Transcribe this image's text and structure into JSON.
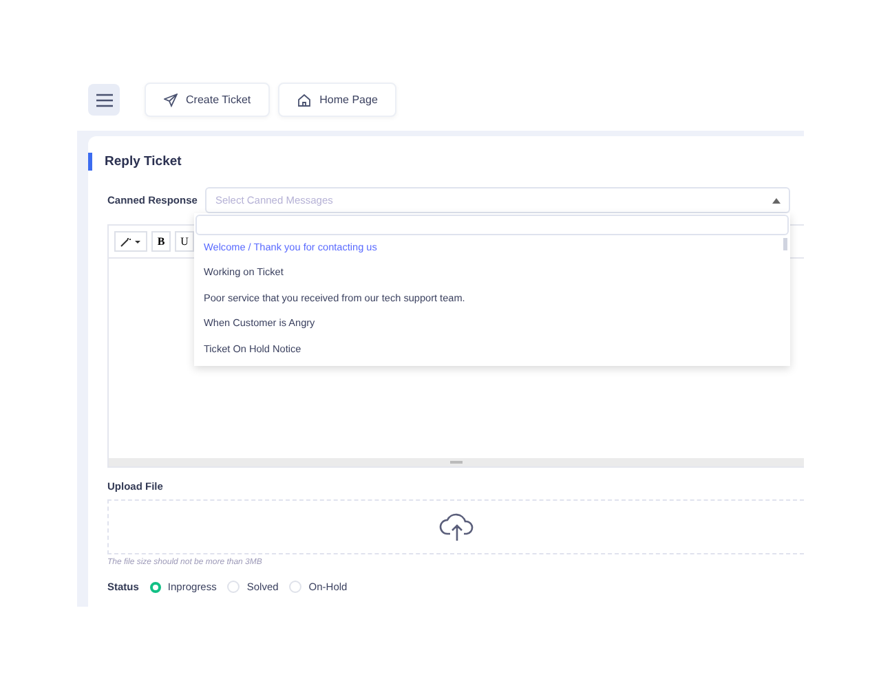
{
  "toolbar": {
    "buttons": [
      {
        "kind": "create",
        "label": "Create Ticket"
      },
      {
        "kind": "home",
        "label": "Home Page"
      }
    ]
  },
  "card": {
    "title": "Reply Ticket",
    "canned_response": {
      "label": "Canned Response",
      "placeholder": "Select Canned Messages",
      "expanded": true,
      "options": [
        {
          "label": "Welcome / Thank you for contacting us",
          "selected": true
        },
        {
          "label": "Working on Ticket",
          "selected": false
        },
        {
          "label": "Poor service that you received from our tech support team.",
          "selected": false
        },
        {
          "label": "When Customer is Angry",
          "selected": false
        },
        {
          "label": "Ticket On Hold Notice",
          "selected": false
        }
      ]
    },
    "editor": {
      "tools": [
        "B",
        "U"
      ]
    },
    "upload": {
      "label": "Upload File",
      "hint": "The file size should not be more than 3MB"
    },
    "status": {
      "label": "Status",
      "options": [
        {
          "label": "Inprogress",
          "selected": true
        },
        {
          "label": "Solved",
          "selected": false
        },
        {
          "label": "On-Hold",
          "selected": false
        }
      ]
    }
  }
}
